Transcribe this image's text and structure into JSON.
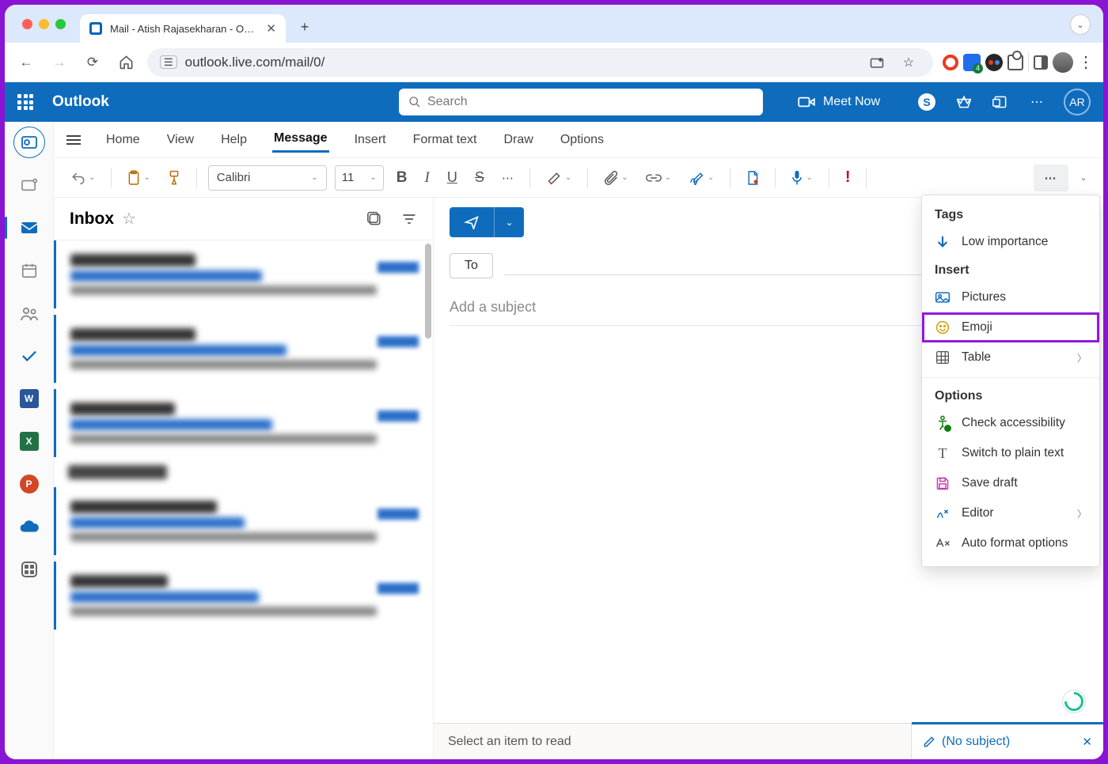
{
  "chrome": {
    "tab_title": "Mail - Atish Rajasekharan - O…",
    "url": "outlook.live.com/mail/0/"
  },
  "header": {
    "app": "Outlook",
    "search_placeholder": "Search",
    "meet_now": "Meet Now",
    "avatar_initials": "AR"
  },
  "ribbon": {
    "tabs": [
      "Home",
      "View",
      "Help",
      "Message",
      "Insert",
      "Format text",
      "Draw",
      "Options"
    ],
    "active": "Message",
    "font_name": "Calibri",
    "font_size": "11"
  },
  "list": {
    "title": "Inbox"
  },
  "compose": {
    "to_label": "To",
    "subject_placeholder": "Add a subject"
  },
  "dropdown": {
    "tags_header": "Tags",
    "low_importance": "Low importance",
    "insert_header": "Insert",
    "pictures": "Pictures",
    "emoji": "Emoji",
    "table": "Table",
    "options_header": "Options",
    "accessibility": "Check accessibility",
    "plain_text": "Switch to plain text",
    "save_draft": "Save draft",
    "editor": "Editor",
    "autoformat": "Auto format options"
  },
  "footer": {
    "select_item": "Select an item to read",
    "no_subject": "(No subject)"
  },
  "rail_apps": {
    "word": "W",
    "excel": "X",
    "ppt": "P"
  }
}
